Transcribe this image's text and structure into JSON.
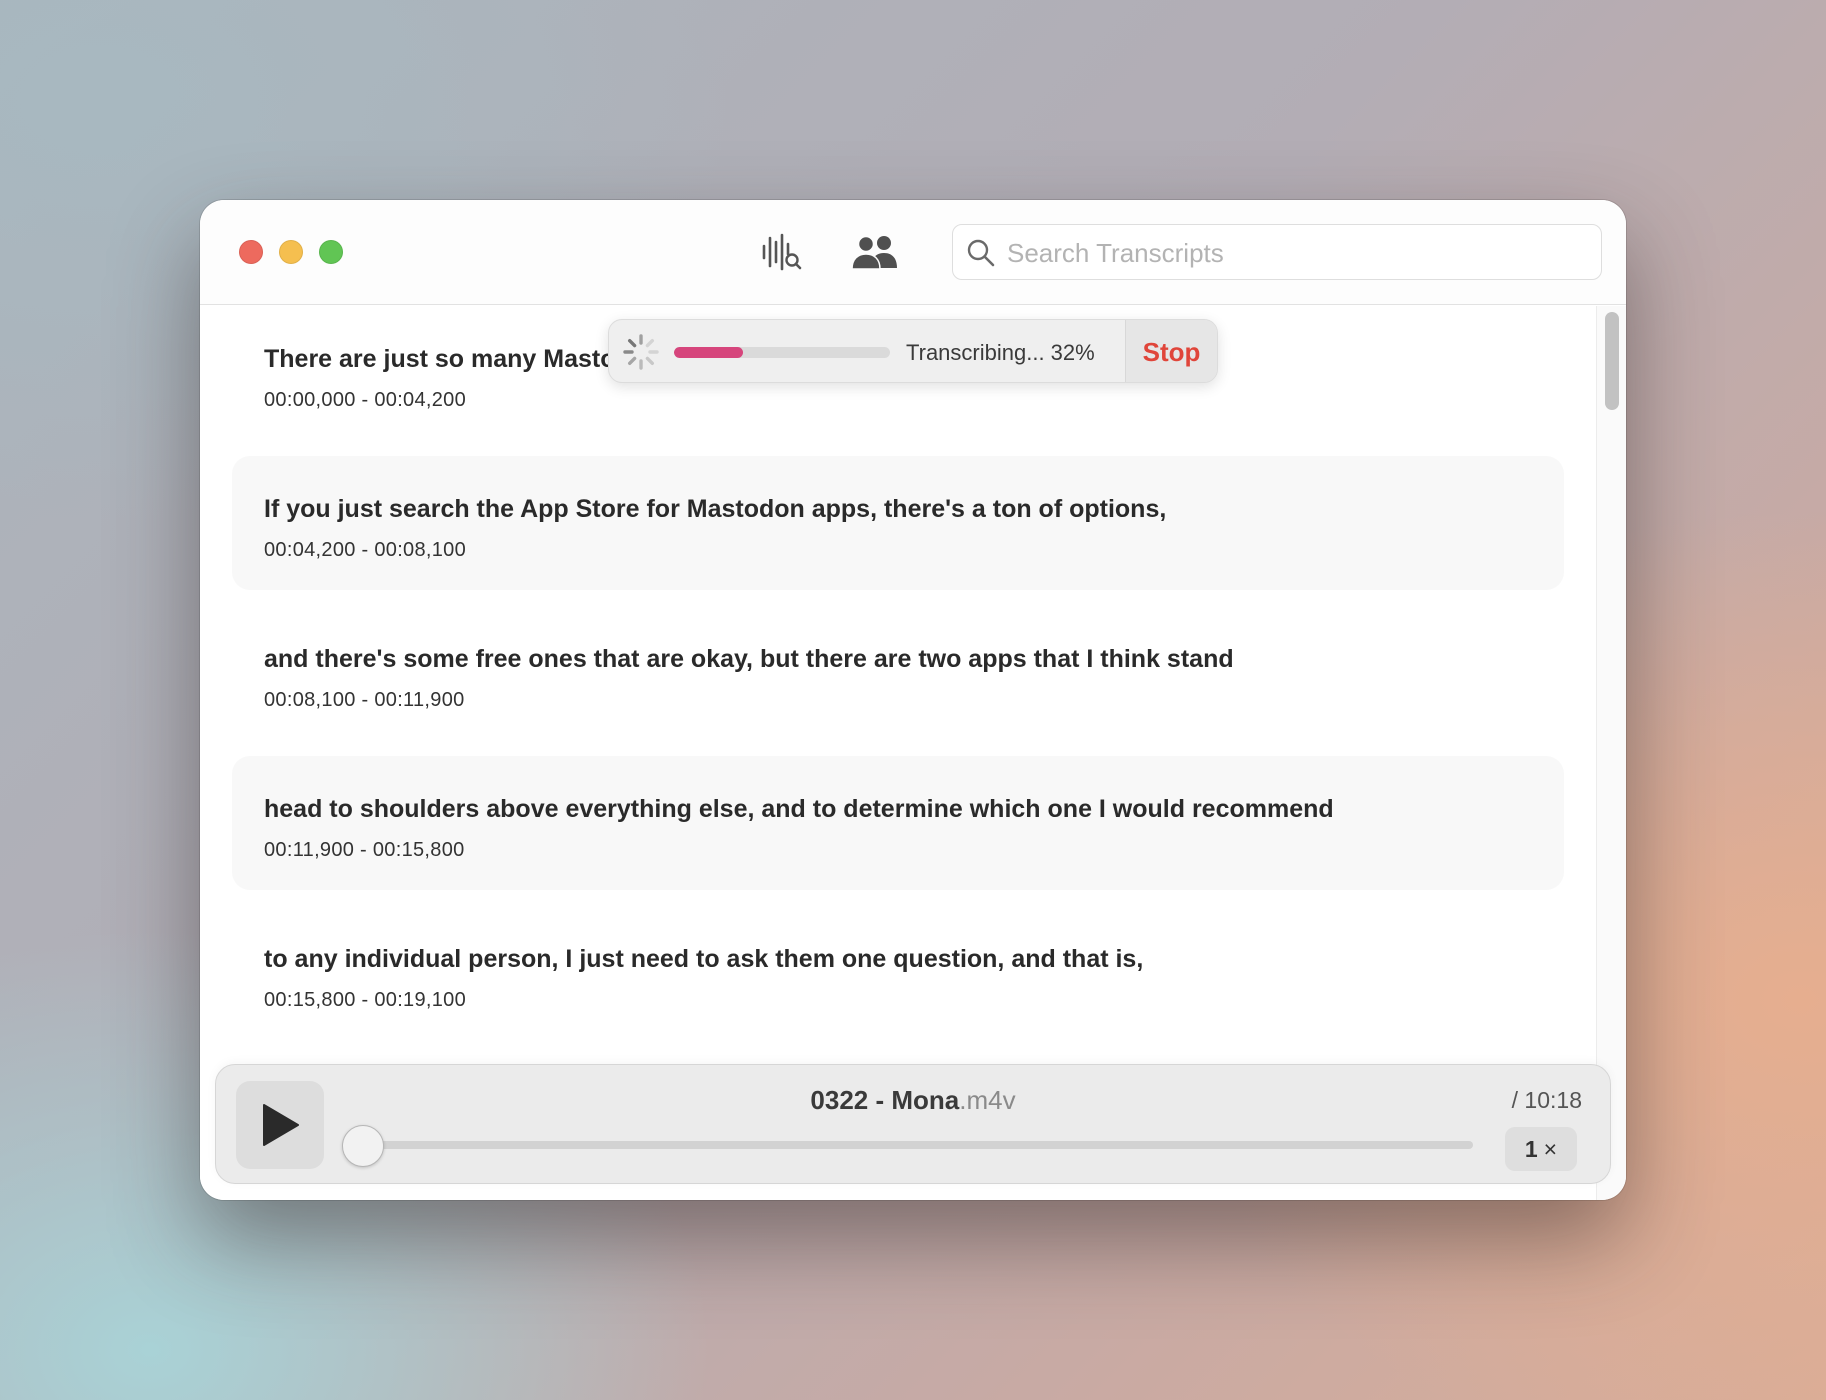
{
  "window": {
    "search": {
      "placeholder": "Search Transcripts"
    },
    "icons": [
      "waveform-search-icon",
      "people-icon",
      "search-icon",
      "spinner-icon",
      "play-icon"
    ]
  },
  "progress": {
    "label": "Transcribing... 32%",
    "fraction": 0.32,
    "stop_label": "Stop",
    "fill_color": "#d6457c",
    "stop_color": "#e0453a"
  },
  "transcript": [
    {
      "text": "There are just so many Mastodon apps out there right now for Apple devices.",
      "time": "00:00,000 - 00:04,200"
    },
    {
      "text": "If you just search the App Store for Mastodon apps, there's a ton of options,",
      "time": "00:04,200 - 00:08,100"
    },
    {
      "text": "and there's some free ones that are okay, but there are two apps that I think stand",
      "time": "00:08,100 - 00:11,900"
    },
    {
      "text": "head to shoulders above everything else, and to determine which one I would recommend",
      "time": "00:11,900 - 00:15,800"
    },
    {
      "text": "to any individual person, I just need to ask them one question, and that is,",
      "time": "00:15,800 - 00:19,100"
    }
  ],
  "player": {
    "file_name": "0322 - Mona",
    "file_ext": ".m4v",
    "duration": "/ 10:18",
    "speed_value": "1",
    "speed_symbol": "×",
    "position_fraction": 0
  }
}
